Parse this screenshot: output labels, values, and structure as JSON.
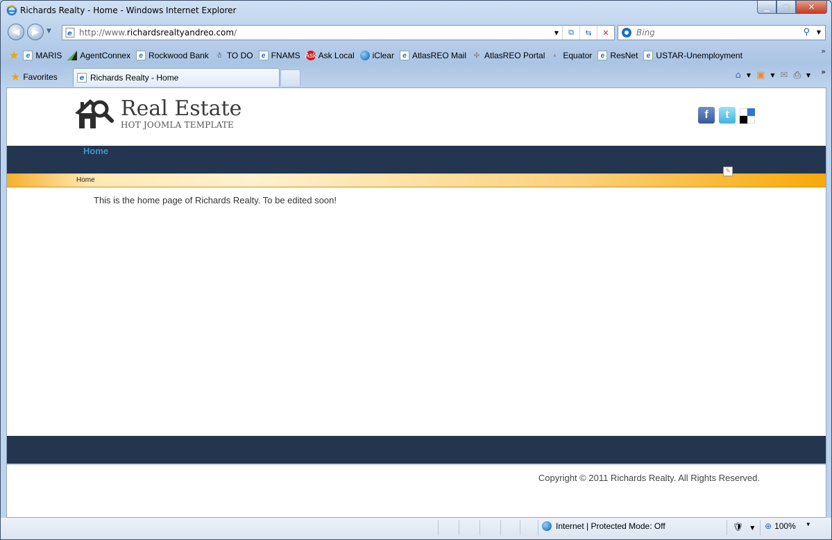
{
  "window": {
    "title": "Richards Realty - Home - Windows Internet Explorer",
    "minimize_glyph": "▁",
    "maximize_glyph": "▢",
    "close_glyph": "✕"
  },
  "nav": {
    "url_prefix": "http://www.",
    "url_domain": "richardsrealtyandreo.com",
    "url_suffix": "/",
    "search_placeholder": "Bing"
  },
  "favorites_bar": {
    "items": [
      {
        "label": "MARIS",
        "icon": "ie-page-icon"
      },
      {
        "label": "AgentConnex",
        "icon": "agentconnex-icon"
      },
      {
        "label": "Rockwood Bank",
        "icon": "ie-page-icon"
      },
      {
        "label": "TO DO",
        "icon": "todo-icon"
      },
      {
        "label": "FNAMS",
        "icon": "ie-page-icon"
      },
      {
        "label": "Ask Local",
        "icon": "ask-icon"
      },
      {
        "label": "iClear",
        "icon": "globe-icon"
      },
      {
        "label": "AtlasREO Mail",
        "icon": "ie-page-icon"
      },
      {
        "label": "AtlasREO Portal",
        "icon": "atlas-icon"
      },
      {
        "label": "Equator",
        "icon": "equator-icon"
      },
      {
        "label": "ResNet",
        "icon": "ie-page-icon"
      },
      {
        "label": "USTAR-Unemployment",
        "icon": "ie-page-icon"
      }
    ]
  },
  "tabs": {
    "favorites_label": "Favorites",
    "active_tab": "Richards Realty - Home"
  },
  "site": {
    "logo_title": "Real Estate",
    "logo_subtitle": "HOT JOOMLA TEMPLATE",
    "nav_home": "Home",
    "breadcrumb": "Home",
    "body_text": "This is the home page of Richards Realty.  To be edited soon!",
    "copyright": "Copyright © 2011 Richards Realty. All Rights Reserved."
  },
  "status": {
    "zone": "Internet | Protected Mode: Off",
    "zoom": "100%"
  },
  "colors": {
    "site_nav": "#243550",
    "home_link": "#3f96c8",
    "breadcrumb_orange": "#f7a90a"
  }
}
